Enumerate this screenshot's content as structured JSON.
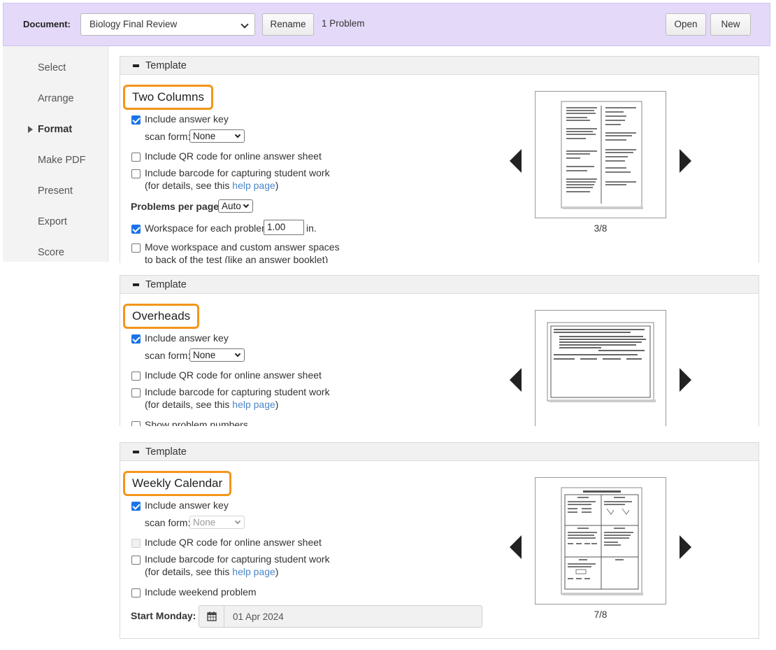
{
  "header": {
    "document_label": "Document:",
    "document_value": "Biology Final Review",
    "rename_label": "Rename",
    "problem_count": "1 Problem",
    "open_label": "Open",
    "new_label": "New"
  },
  "sidebar": {
    "items": [
      {
        "label": "Select"
      },
      {
        "label": "Arrange"
      },
      {
        "label": "Format",
        "active": true
      },
      {
        "label": "Make PDF"
      },
      {
        "label": "Present"
      },
      {
        "label": "Export"
      },
      {
        "label": "Score"
      }
    ]
  },
  "panels": [
    {
      "header": "Template",
      "title": "Two Columns",
      "include_answer_key": "Include answer key",
      "scan_form_label": "scan form:",
      "scan_form_value": "None",
      "qr_label": "Include QR code for online answer sheet",
      "barcode_label": "Include barcode for capturing student work",
      "details_prefix": "(for details, see this ",
      "details_link": "help page",
      "details_suffix": ")",
      "ppp_label": "Problems per page:",
      "ppp_value": "Auto",
      "workspace_label": "Workspace for each problem",
      "workspace_value": "1.00",
      "workspace_unit": "in.",
      "move_ws_line1": "Move workspace and custom answer spaces",
      "move_ws_line2": "to back of the test (like an answer booklet)",
      "page_indicator": "3/8"
    },
    {
      "header": "Template",
      "title": "Overheads",
      "include_answer_key": "Include answer key",
      "scan_form_label": "scan form:",
      "scan_form_value": "None",
      "qr_label": "Include QR code for online answer sheet",
      "barcode_label": "Include barcode for capturing student work",
      "details_prefix": "(for details, see this ",
      "details_link": "help page",
      "details_suffix": ")",
      "show_numbers_label": "Show problem numbers"
    },
    {
      "header": "Template",
      "title": "Weekly Calendar",
      "include_answer_key": "Include answer key",
      "scan_form_label": "scan form:",
      "scan_form_value": "None",
      "qr_label": "Include QR code for online answer sheet",
      "barcode_label": "Include barcode for capturing student work",
      "details_prefix": "(for details, see this ",
      "details_link": "help page",
      "details_suffix": ")",
      "weekend_label": "Include weekend problem",
      "start_monday_label": "Start Monday:",
      "start_monday_value": "01 Apr 2024",
      "page_indicator": "7/8"
    }
  ],
  "colors": {
    "header_bg": "#e4d9f9",
    "highlight": "#f4951b",
    "link": "#4a86c8",
    "checkbox": "#1a73e8"
  }
}
